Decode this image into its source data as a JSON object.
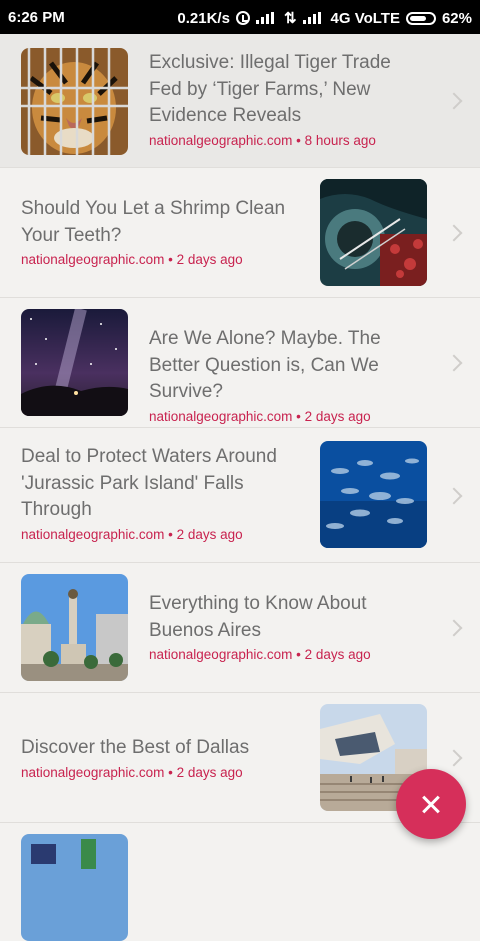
{
  "status_bar": {
    "time": "6:26 PM",
    "net_speed": "0.21K/s",
    "network": "4G VoLTE",
    "battery": "62%"
  },
  "articles": [
    {
      "title": "Exclusive: Illegal Tiger Trade Fed by ‘Tiger Farms,’ New Evidence Reveals",
      "meta": "nationalgeographic.com • 8 hours ago"
    },
    {
      "title": "Should You Let a Shrimp Clean Your Teeth?",
      "meta": "nationalgeographic.com • 2 days ago"
    },
    {
      "title": "Are We Alone? Maybe. The Better Question is, Can We Survive?",
      "meta": "nationalgeographic.com • 2 days ago"
    },
    {
      "title": "Deal to Protect Waters Around 'Jurassic Park Island' Falls Through",
      "meta": "nationalgeographic.com • 2 days ago"
    },
    {
      "title": "Everything to Know About Buenos Aires",
      "meta": "nationalgeographic.com • 2 days ago"
    },
    {
      "title": "Discover the Best of Dallas",
      "meta": "nationalgeographic.com • 2 days ago"
    }
  ],
  "colors": {
    "accent": "#d62f5a",
    "meta_text": "#c8234f",
    "title_text": "#6e6e6e",
    "background": "#f3f2f0"
  },
  "icons": {
    "fab": "close-icon",
    "row": "chevron-right-icon"
  }
}
